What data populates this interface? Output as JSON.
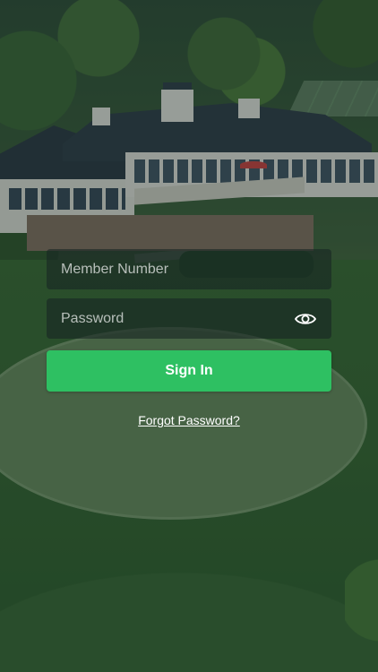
{
  "login": {
    "member_number_placeholder": "Member Number",
    "member_number_value": "",
    "password_placeholder": "Password",
    "password_value": "",
    "sign_in_label": "Sign In",
    "forgot_password_label": "Forgot Password?"
  },
  "icons": {
    "password_toggle": "eye-icon"
  },
  "colors": {
    "sign_in_button": "#2ec062",
    "field_background": "rgba(25,38,36,0.62)",
    "text": "#ffffff"
  }
}
